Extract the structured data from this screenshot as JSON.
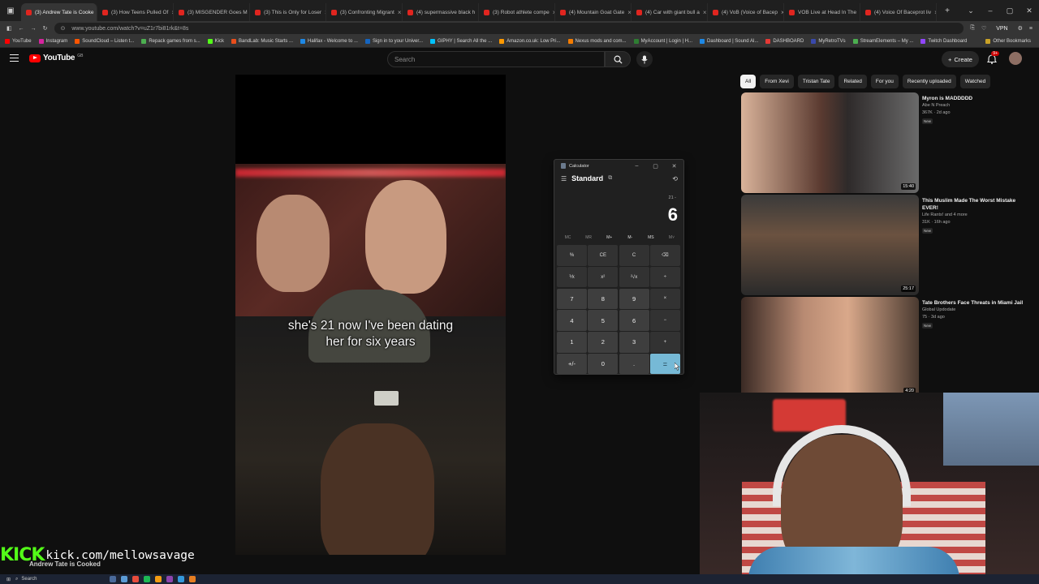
{
  "browser": {
    "tabs": [
      {
        "label": "(3) Andrew Tate is Cooke",
        "active": true
      },
      {
        "label": "(3) How Teens Pulled Of"
      },
      {
        "label": "(3) MISGENDER Goes M"
      },
      {
        "label": "(3) This is Only for Loser"
      },
      {
        "label": "(3) Confronting Migrant"
      },
      {
        "label": "(4) supermassive black h"
      },
      {
        "label": "(3) Robot athlete compe"
      },
      {
        "label": "(4) Mountain Goat Gate"
      },
      {
        "label": "(4) Car with giant bull a"
      },
      {
        "label": "(4) VoB (Voice of Bacep"
      },
      {
        "label": "VOB Live at Head In The"
      },
      {
        "label": "(4) Voice Of Baceprot liv"
      }
    ],
    "new_tab": "+",
    "url": "www.youtube.com/watch?v=uZ1r7bi81rk&t=8s",
    "vpn_label": "VPN",
    "bookmarks": [
      "YouTube",
      "Instagram",
      "SoundCloud – Listen t...",
      "Repack games from s...",
      "Kick",
      "BandLab: Music Starts ...",
      "Halifax - Welcome to ...",
      "Sign in to your Univer...",
      "GIPHY | Search All the ...",
      "Amazon.co.uk: Low Pri...",
      "Nexus mods and com...",
      "MyAccount | Login | H...",
      "Dashboard | Sound Al...",
      "DASHBOARD",
      "MyRetroTVs",
      "StreamElements – My ...",
      "Twitch Dashboard"
    ],
    "other_bookmarks": "Other Bookmarks"
  },
  "youtube": {
    "logo": "YouTube",
    "country": "GB",
    "search_placeholder": "Search",
    "create_label": "Create",
    "notif_count": "9+",
    "subtitle_line1": "she's 21 now I've been dating",
    "subtitle_line2": "her for six years",
    "chips": [
      "All",
      "From Xevi",
      "Tristan Tate",
      "Related",
      "For you",
      "Recently uploaded",
      "Watched"
    ],
    "recommendations": [
      {
        "title": "Myron is MADDDDD",
        "channel": "Abe N Preach",
        "meta": "367K · 2d ago",
        "badge": "New",
        "duration": "15:40"
      },
      {
        "title": "This Muslim Made The Worst Mistake EVER!",
        "channel": "Life Rants! and 4 more",
        "meta": "31K · 16h ago",
        "badge": "New",
        "duration": "25:17"
      },
      {
        "title": "Tate Brothers Face Threats in Miami Jail",
        "channel": "Global Updodate",
        "meta": "75 · 3d ago",
        "badge": "New",
        "duration": "4:20"
      }
    ]
  },
  "calculator": {
    "title": "Calculator",
    "mode": "Standard",
    "expression": "21 -",
    "display": "6",
    "memory": [
      "MC",
      "MR",
      "M+",
      "M-",
      "MS",
      "M˅"
    ],
    "keys": [
      "%",
      "CE",
      "C",
      "⌫",
      "⅟x",
      "x²",
      "²√x",
      "÷",
      "7",
      "8",
      "9",
      "×",
      "4",
      "5",
      "6",
      "−",
      "1",
      "2",
      "3",
      "+",
      "+/-",
      "0",
      ".",
      "="
    ]
  },
  "overlay": {
    "kick_logo": "KICK",
    "kick_handle": "kick.com/mellowsavage",
    "now_playing": "Andrew Tate is Cooked"
  },
  "taskbar": {
    "search_label": "Search"
  },
  "colors": {
    "kick_green": "#53fc18",
    "youtube_red": "#ff0000",
    "calc_equals": "#76b9d6"
  }
}
